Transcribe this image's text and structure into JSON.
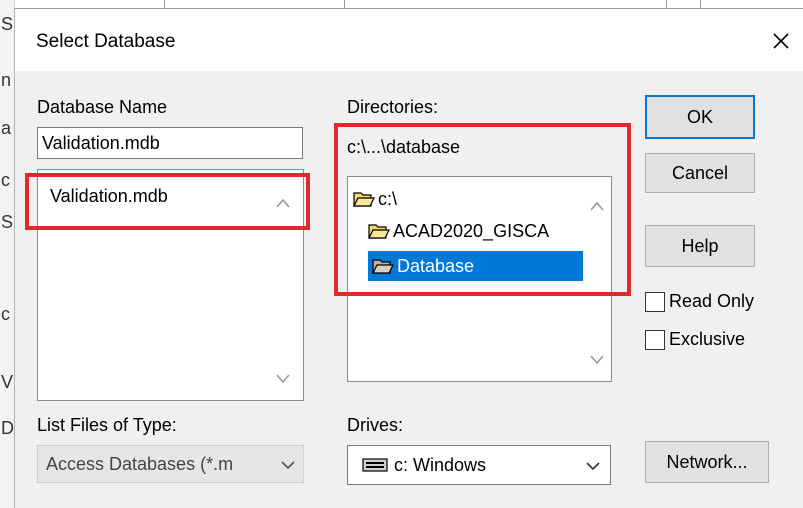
{
  "background_fragments": [
    "S",
    "n",
    "a",
    "c",
    "S",
    "c",
    "V",
    "D"
  ],
  "dialog": {
    "title": "Select Database",
    "database_name": {
      "label": "Database Name",
      "value": "Validation.mdb",
      "files": [
        "Validation.mdb"
      ]
    },
    "directories": {
      "label": "Directories:",
      "current_path": "c:\\...\\database",
      "tree": [
        {
          "label": "c:\\",
          "icon": "open-folder-icon",
          "selected": false
        },
        {
          "label": "ACAD2020_GISCA",
          "icon": "open-folder-icon",
          "selected": false
        },
        {
          "label": "Database",
          "icon": "open-folder-icon",
          "selected": true
        }
      ]
    },
    "buttons": {
      "ok": "OK",
      "cancel": "Cancel",
      "help": "Help",
      "network": "Network..."
    },
    "checkboxes": {
      "read_only": {
        "label": "Read Only",
        "checked": false
      },
      "exclusive": {
        "label": "Exclusive",
        "checked": false
      }
    },
    "file_type": {
      "label": "List Files of Type:",
      "value": "Access Databases (*.m"
    },
    "drives": {
      "label": "Drives:",
      "value": "c: Windows",
      "icon": "drive-icon"
    }
  },
  "colors": {
    "dialog_bg": "#f0f0f0",
    "selection": "#0078d7",
    "highlight_box": "#e0282e"
  }
}
